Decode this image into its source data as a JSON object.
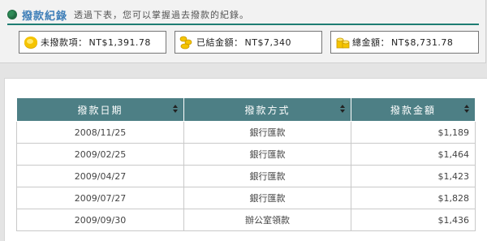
{
  "header": {
    "title": "撥款紀錄",
    "description": "透過下表，您可以掌握過去撥款的紀錄。"
  },
  "summary": {
    "unpaid": {
      "label": "未撥款項：",
      "value": "NT$1,391.78",
      "icon": "single-coin-icon"
    },
    "paid": {
      "label": "已結金額：",
      "value": "NT$7,340",
      "icon": "coin-pile-icon"
    },
    "total": {
      "label": "總金額：",
      "value": "NT$8,731.78",
      "icon": "coin-stack-icon"
    }
  },
  "table": {
    "columns": [
      "撥款日期",
      "撥款方式",
      "撥款金額"
    ],
    "rows": [
      {
        "date": "2008/11/25",
        "method": "銀行匯款",
        "amount": "$1,189"
      },
      {
        "date": "2009/02/25",
        "method": "銀行匯款",
        "amount": "$1,464"
      },
      {
        "date": "2009/04/27",
        "method": "銀行匯款",
        "amount": "$1,423"
      },
      {
        "date": "2009/07/27",
        "method": "銀行匯款",
        "amount": "$1,828"
      },
      {
        "date": "2009/09/30",
        "method": "辦公室領款",
        "amount": "$1,436"
      }
    ]
  },
  "colors": {
    "accent_title": "#3f7fb8",
    "rule": "#1e7d73",
    "table_header": "#4d7f85",
    "coin": "#f5c400"
  }
}
